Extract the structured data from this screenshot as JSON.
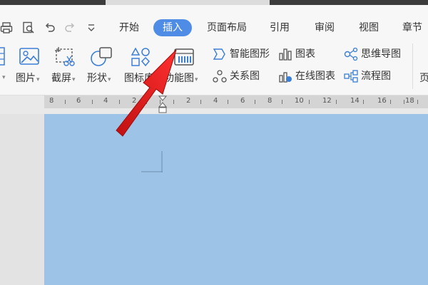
{
  "tabbar": {
    "tabs": [
      {
        "label": "开始"
      },
      {
        "label": "插入"
      },
      {
        "label": "页面布局"
      },
      {
        "label": "引用"
      },
      {
        "label": "审阅"
      },
      {
        "label": "视图"
      },
      {
        "label": "章节"
      }
    ],
    "active_tab": "插入"
  },
  "ribbon": {
    "large_buttons": [
      {
        "label": "图片",
        "icon": "image-icon"
      },
      {
        "label": "截屏",
        "icon": "screenshot-icon"
      },
      {
        "label": "形状",
        "icon": "shapes-icon"
      },
      {
        "label": "图标库",
        "icon": "icon-library-icon"
      },
      {
        "label": "功能图",
        "icon": "function-chart-icon"
      }
    ],
    "small_buttons": [
      {
        "label": "智能图形",
        "icon": "smart-art-icon"
      },
      {
        "label": "关系图",
        "icon": "relation-chart-icon"
      },
      {
        "label": "图表",
        "icon": "chart-icon"
      },
      {
        "label": "在线图表",
        "icon": "online-chart-icon"
      },
      {
        "label": "思维导图",
        "icon": "mind-map-icon"
      },
      {
        "label": "流程图",
        "icon": "flowchart-icon"
      }
    ],
    "overflow_label": "页"
  },
  "ruler": {
    "numbers": [
      "8",
      "6",
      "4",
      "2",
      "2",
      "4",
      "6",
      "8",
      "10",
      "12",
      "14",
      "16",
      "18"
    ]
  },
  "colors": {
    "accent": "#4f8ce6",
    "page": "#9dc3e6",
    "arrow": "#e02020"
  }
}
